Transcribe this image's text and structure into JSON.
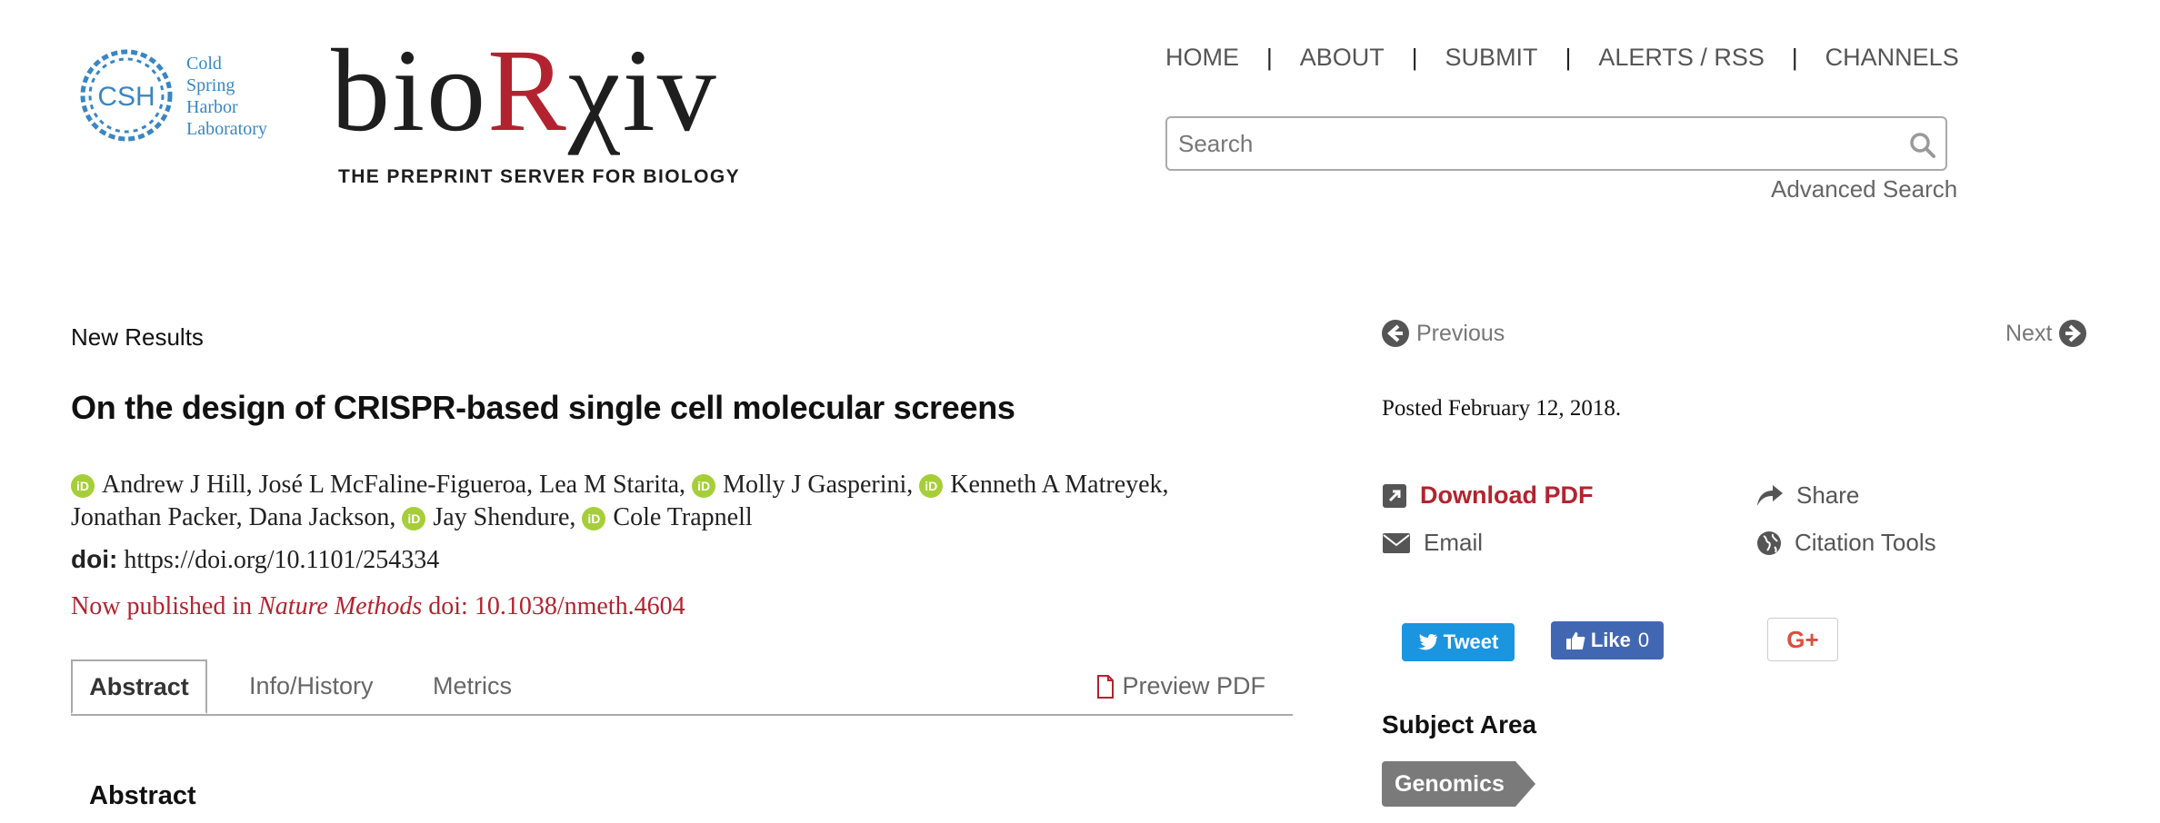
{
  "header": {
    "csh_logo_text": "CSH",
    "csh_name_lines": [
      "Cold",
      "Spring",
      "Harbor",
      "Laboratory"
    ],
    "brand_prefix": "bio",
    "brand_r": "R",
    "brand_suffix": "χiv",
    "tagline": "THE PREPRINT SERVER FOR BIOLOGY",
    "nav": [
      "HOME",
      "ABOUT",
      "SUBMIT",
      "ALERTS / RSS",
      "CHANNELS"
    ],
    "nav_separator": "|",
    "search_placeholder": "Search",
    "advanced_search": "Advanced Search"
  },
  "article": {
    "section": "New Results",
    "title": "On the design of CRISPR-based single cell molecular screens",
    "orcid_badge": "iD",
    "authors_line1": [
      {
        "name": "Andrew J Hill,",
        "orcid": true
      },
      {
        "name": "José L McFaline-Figueroa,",
        "orcid": false
      },
      {
        "name": "Lea M Starita,",
        "orcid": false
      },
      {
        "name": "Molly J Gasperini,",
        "orcid": true
      },
      {
        "name": "Kenneth A Matreyek,",
        "orcid": true
      }
    ],
    "authors_line2": [
      {
        "name": "Jonathan Packer,",
        "orcid": false
      },
      {
        "name": "Dana Jackson,",
        "orcid": false
      },
      {
        "name": "Jay Shendure,",
        "orcid": true
      },
      {
        "name": "Cole Trapnell",
        "orcid": true
      }
    ],
    "doi_label": "doi:",
    "doi_value": "https://doi.org/10.1101/254334",
    "published_prefix": "Now published in",
    "published_journal": "Nature Methods",
    "published_doi": "doi: 10.1038/nmeth.4604",
    "tabs": {
      "abstract": "Abstract",
      "info": "Info/History",
      "metrics": "Metrics",
      "preview_pdf": "Preview PDF"
    },
    "abstract_heading": "Abstract"
  },
  "sidebar": {
    "previous": "Previous",
    "next": "Next",
    "posted": "Posted February 12, 2018.",
    "download_pdf": "Download PDF",
    "share": "Share",
    "email": "Email",
    "citation_tools": "Citation Tools",
    "tweet": "Tweet",
    "like": "Like",
    "like_count": "0",
    "gplus": "G+",
    "subject_area_heading": "Subject Area",
    "subject": "Genomics"
  },
  "colors": {
    "brand_red": "#b3232f",
    "csh_blue": "#3a86c4",
    "orcid_green": "#a6ce39",
    "twitter_blue": "#1b95e0",
    "facebook_blue": "#4267b2"
  }
}
